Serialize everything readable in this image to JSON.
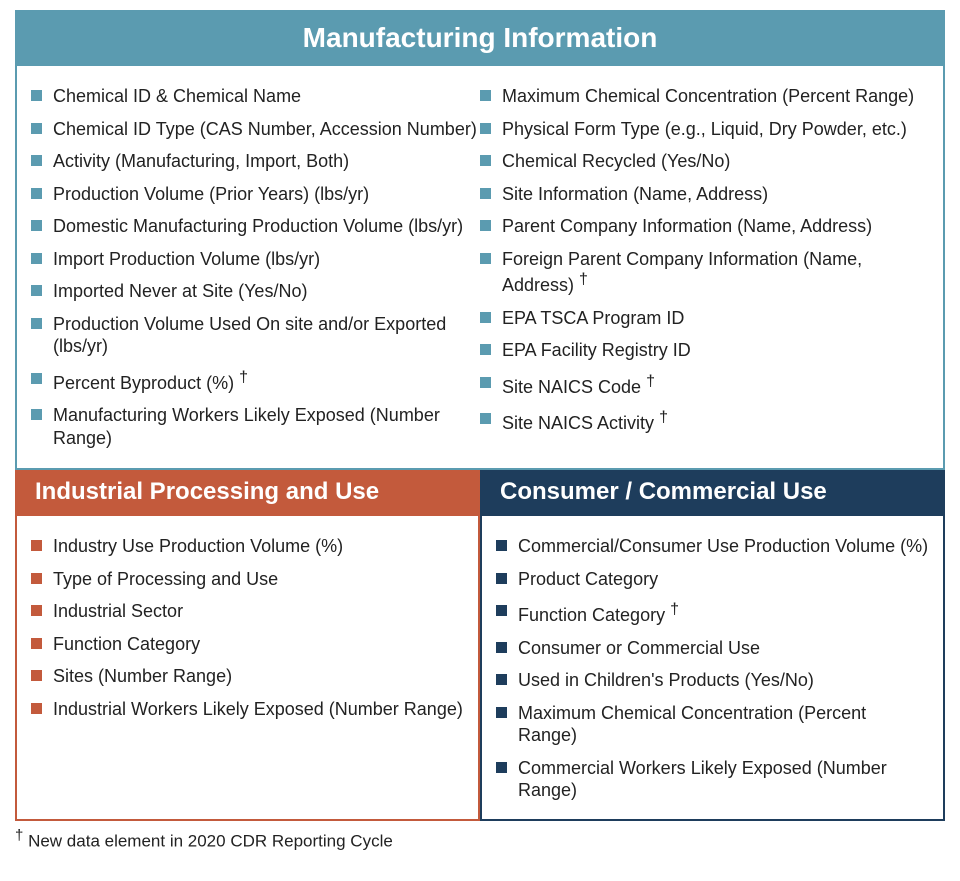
{
  "dagger": "†",
  "manufacturing": {
    "title": "Manufacturing Information",
    "left": [
      {
        "text": "Chemical ID & Chemical Name"
      },
      {
        "text": "Chemical ID Type (CAS Number, Accession Number)"
      },
      {
        "text": "Activity (Manufacturing, Import, Both)"
      },
      {
        "text": "Production Volume (Prior Years) (lbs/yr)"
      },
      {
        "text": "Domestic Manufacturing Production Volume (lbs/yr)"
      },
      {
        "text": "Import Production Volume (lbs/yr)"
      },
      {
        "text": "Imported Never at Site (Yes/No)"
      },
      {
        "text": "Production Volume Used On site and/or Exported (lbs/yr)"
      },
      {
        "text": "Percent Byproduct (%)",
        "dagger": true
      },
      {
        "text": "Manufacturing Workers Likely Exposed (Number Range)"
      }
    ],
    "right": [
      {
        "text": "Maximum Chemical Concentration (Percent Range)"
      },
      {
        "text": "Physical Form Type (e.g., Liquid, Dry Powder, etc.)"
      },
      {
        "text": "Chemical Recycled (Yes/No)"
      },
      {
        "text": "Site Information (Name, Address)"
      },
      {
        "text": "Parent Company Information (Name, Address)"
      },
      {
        "text": "Foreign Parent Company Information (Name, Address)",
        "dagger": true
      },
      {
        "text": "EPA TSCA Program ID"
      },
      {
        "text": "EPA Facility Registry ID"
      },
      {
        "text": "Site NAICS Code",
        "dagger": true
      },
      {
        "text": "Site NAICS Activity",
        "dagger": true
      }
    ]
  },
  "industrial": {
    "title": "Industrial Processing and Use",
    "items": [
      {
        "text": "Industry Use Production Volume (%)"
      },
      {
        "text": "Type of Processing and Use"
      },
      {
        "text": "Industrial Sector"
      },
      {
        "text": "Function Category"
      },
      {
        "text": "Sites (Number Range)"
      },
      {
        "text": "Industrial Workers Likely Exposed (Number Range)"
      }
    ]
  },
  "consumer": {
    "title": "Consumer / Commercial Use",
    "items": [
      {
        "text": "Commercial/Consumer Use Production Volume (%)"
      },
      {
        "text": "Product Category"
      },
      {
        "text": "Function Category",
        "dagger": true
      },
      {
        "text": "Consumer or Commercial Use"
      },
      {
        "text": "Used in Children's Products (Yes/No)"
      },
      {
        "text": "Maximum Chemical Concentration (Percent Range)"
      },
      {
        "text": "Commercial Workers Likely Exposed (Number Range)"
      }
    ]
  },
  "footnote": "New data element in 2020 CDR Reporting Cycle"
}
